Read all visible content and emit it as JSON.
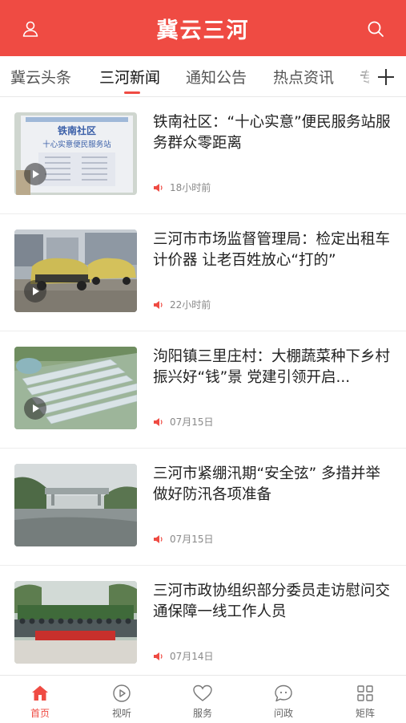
{
  "header": {
    "title": "冀云三河",
    "left_icon": "user-icon",
    "right_icon": "search-icon"
  },
  "tabs": {
    "items": [
      "冀云头条",
      "三河新闻",
      "通知公告",
      "热点资讯"
    ],
    "partial_item": "专",
    "active_index": 1,
    "add_icon": "plus-icon"
  },
  "news": [
    {
      "title": "铁南社区：“十心实意”便民服务站服务群众零距离",
      "time": "18小时前",
      "video": true,
      "thumb_text": {
        "line1": "铁南社区",
        "line2": "十心实意便民服务站"
      }
    },
    {
      "title": "三河市市场监督管理局：检定出租车计价器 让老百姓放心“打的”",
      "time": "22小时前",
      "video": true
    },
    {
      "title": "泃阳镇三里庄村：大棚蔬菜种下乡村振兴好“钱”景 党建引领开启...",
      "time": "07月15日",
      "video": true
    },
    {
      "title": "三河市紧绷汛期“安全弦” 多措并举做好防汛各项准备",
      "time": "07月15日",
      "video": false
    },
    {
      "title": "三河市政协组织部分委员走访慰问交通保障一线工作人员",
      "time": "07月14日",
      "video": false
    }
  ],
  "bottom_nav": [
    {
      "label": "首页",
      "icon": "home-icon",
      "active": true
    },
    {
      "label": "视听",
      "icon": "play-circle-icon",
      "active": false
    },
    {
      "label": "服务",
      "icon": "heart-icon",
      "active": false
    },
    {
      "label": "问政",
      "icon": "chat-bubble-icon",
      "active": false
    },
    {
      "label": "矩阵",
      "icon": "grid-icon",
      "active": false
    }
  ],
  "colors": {
    "brand": "#ef4b43",
    "text": "#222222",
    "muted": "#888888"
  }
}
